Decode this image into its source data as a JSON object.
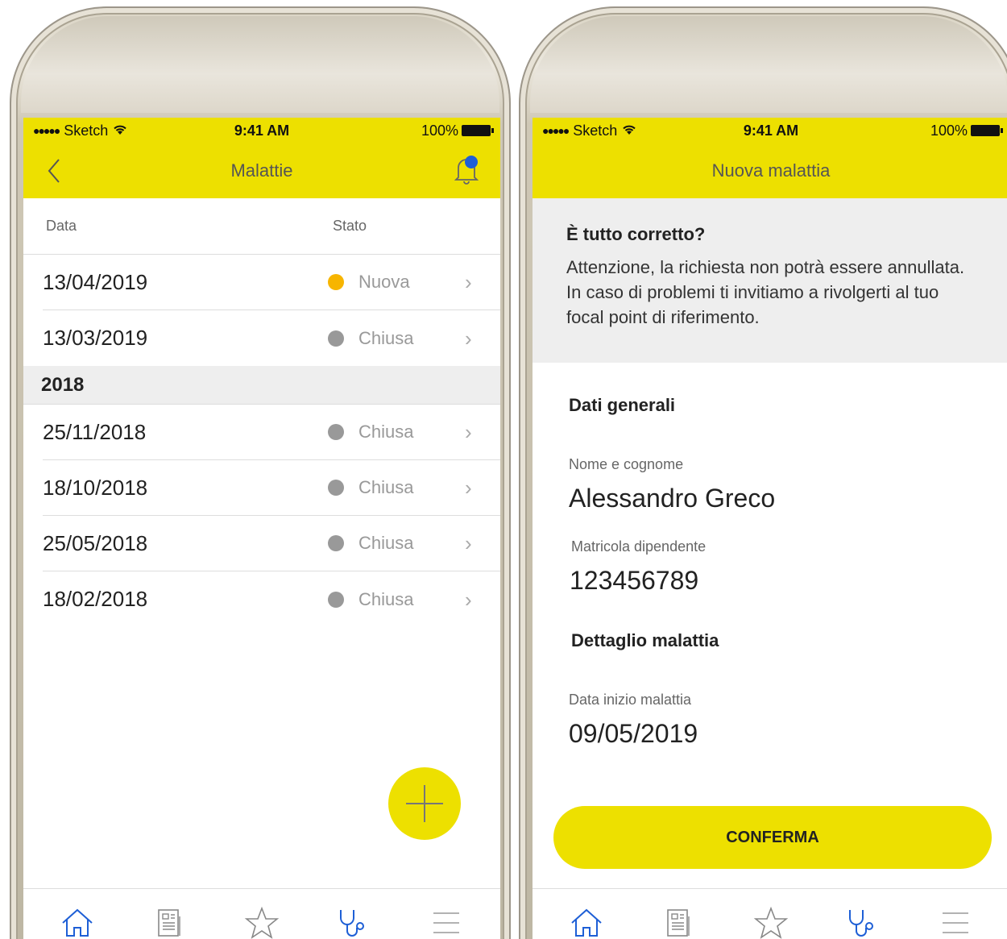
{
  "left": {
    "status": {
      "carrier": "Sketch",
      "time": "9:41 AM",
      "battery": "100%"
    },
    "title": "Malattie",
    "columns": {
      "date": "Data",
      "status": "Stato"
    },
    "rows_current": [
      {
        "date": "13/04/2019",
        "status": "Nuova",
        "dot_color": "#f7b500"
      },
      {
        "date": "13/03/2019",
        "status": "Chiusa",
        "dot_color": "#999999"
      }
    ],
    "section_2018": "2018",
    "rows_2018": [
      {
        "date": "25/11/2018",
        "status": "Chiusa",
        "dot_color": "#999999"
      },
      {
        "date": "18/10/2018",
        "status": "Chiusa",
        "dot_color": "#999999"
      },
      {
        "date": "25/05/2018",
        "status": "Chiusa",
        "dot_color": "#999999"
      },
      {
        "date": "18/02/2018",
        "status": "Chiusa",
        "dot_color": "#999999"
      }
    ]
  },
  "right": {
    "status": {
      "carrier": "Sketch",
      "time": "9:41 AM",
      "battery": "100%"
    },
    "title": "Nuova malattia",
    "warning_title": "È tutto corretto?",
    "warning_text": "Attenzione, la richiesta non potrà essere annullata. In caso di problemi ti invitiamo a rivolgerti al tuo focal point di riferimento.",
    "general_title": "Dati generali",
    "name_label": "Nome e cognome",
    "name_value": "Alessandro Greco",
    "id_label": "Matricola dipendente",
    "id_value": "123456789",
    "detail_title": "Dettaglio malattia",
    "start_label": "Data inizio malattia",
    "start_value": "09/05/2019",
    "confirm_label": "CONFERMA"
  },
  "colors": {
    "accent": "#ede000",
    "active_tab": "#1e5fd6",
    "new_status": "#f7b500"
  },
  "tabs": [
    "home-icon",
    "news-icon",
    "star-icon",
    "stethoscope-icon",
    "menu-icon"
  ]
}
